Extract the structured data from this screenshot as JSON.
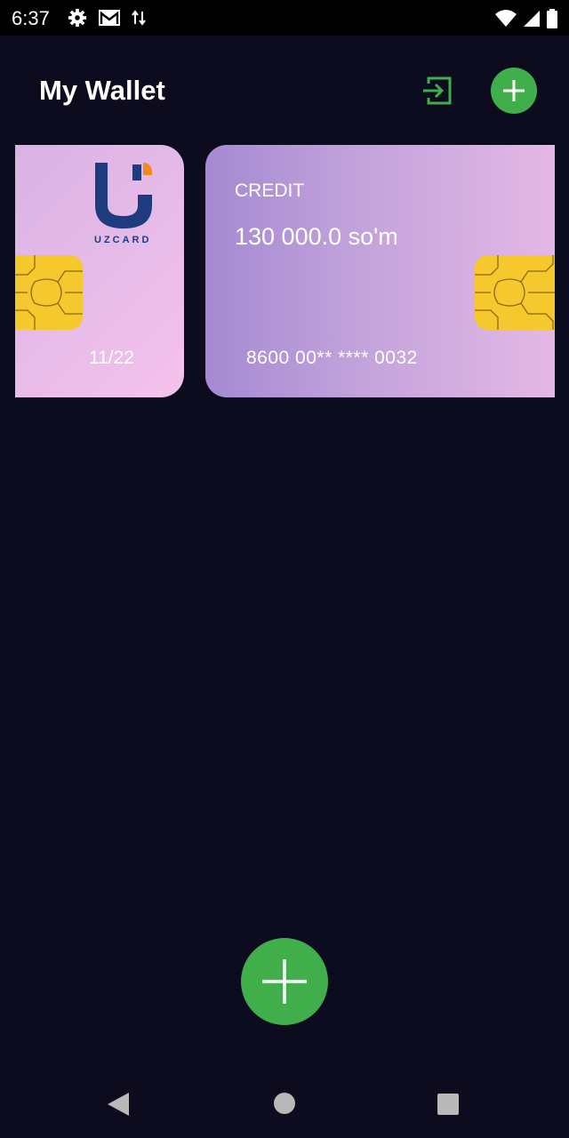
{
  "status_bar": {
    "time": "6:37",
    "left_icons": [
      "settings-icon",
      "gmail-icon",
      "data-transfer-icon"
    ],
    "right_icons": [
      "wifi-icon",
      "signal-icon",
      "battery-icon"
    ]
  },
  "header": {
    "title": "My Wallet",
    "logout_icon": "logout-icon",
    "add_icon": "plus-icon"
  },
  "cards": [
    {
      "brand": "UZCARD",
      "expiry": "11/22"
    },
    {
      "type": "CREDIT",
      "amount": "130 000.0 so'm",
      "number": "8600 00** **** 0032"
    }
  ],
  "fab": {
    "icon": "plus-icon"
  },
  "nav": [
    "back-icon",
    "home-icon",
    "recents-icon"
  ],
  "colors": {
    "background": "#0d0b1e",
    "accent_green": "#3fae4b",
    "chip_gold": "#f5c92e",
    "uzcard_blue": "#1f3b80",
    "uzcard_orange": "#f08a1c"
  }
}
